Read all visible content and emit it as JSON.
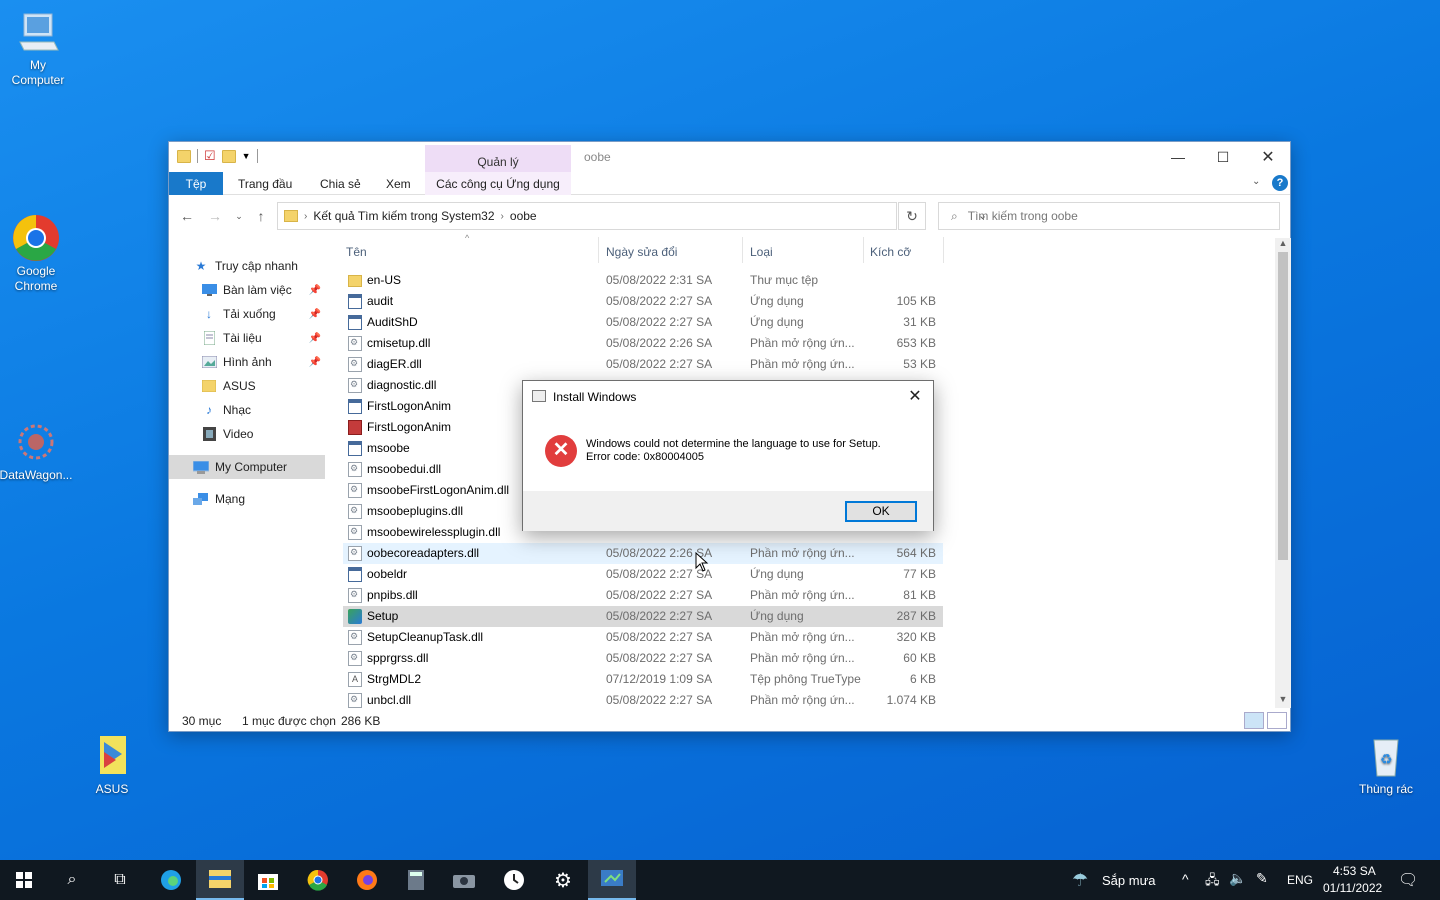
{
  "desktop": {
    "icons": [
      {
        "label": "My\nComputer",
        "line1": "My",
        "line2": "Computer"
      },
      {
        "line1": "Google",
        "line2": "Chrome"
      },
      {
        "line1": "DataWagon..."
      },
      {
        "line1": "ASUS"
      },
      {
        "line1": "Thùng rác"
      }
    ]
  },
  "explorer": {
    "title": "oobe",
    "manage_tab": "Quản lý",
    "ribbon_tabs": [
      "Tệp",
      "Trang đầu",
      "Chia sẻ",
      "Xem",
      "Các công cụ Ứng dụng"
    ],
    "address": {
      "crumb1": "Kết quả Tìm kiếm trong System32",
      "crumb2": "oobe"
    },
    "search_placeholder": "Tìm kiếm trong oobe",
    "nav": [
      {
        "label": "Truy cập nhanh",
        "icon": "star-icon"
      },
      {
        "label": "Bàn làm việc",
        "icon": "desktop-icon",
        "pinned": true
      },
      {
        "label": "Tải xuống",
        "icon": "download-icon",
        "pinned": true
      },
      {
        "label": "Tài liệu",
        "icon": "document-icon",
        "pinned": true
      },
      {
        "label": "Hình ảnh",
        "icon": "picture-icon",
        "pinned": true
      },
      {
        "label": "ASUS",
        "icon": "folder-icon"
      },
      {
        "label": "Nhạc",
        "icon": "music-icon"
      },
      {
        "label": "Video",
        "icon": "video-icon"
      },
      {
        "label": "My Computer",
        "icon": "computer-icon",
        "selected": true
      },
      {
        "label": "Mạng",
        "icon": "network-icon"
      }
    ],
    "columns": [
      "Tên",
      "Ngày sửa đổi",
      "Loại",
      "Kích cỡ"
    ],
    "files": [
      {
        "name": "en-US",
        "date": "05/08/2022 2:31 SA",
        "type": "Thư mục tệp",
        "size": "",
        "icon": "folder"
      },
      {
        "name": "audit",
        "date": "05/08/2022 2:27 SA",
        "type": "Ứng dụng",
        "size": "105 KB",
        "icon": "app"
      },
      {
        "name": "AuditShD",
        "date": "05/08/2022 2:27 SA",
        "type": "Ứng dụng",
        "size": "31 KB",
        "icon": "app"
      },
      {
        "name": "cmisetup.dll",
        "date": "05/08/2022 2:26 SA",
        "type": "Phần mở rộng ứn...",
        "size": "653 KB",
        "icon": "dll"
      },
      {
        "name": "diagER.dll",
        "date": "05/08/2022 2:27 SA",
        "type": "Phần mở rộng ứn...",
        "size": "53 KB",
        "icon": "dll"
      },
      {
        "name": "diagnostic.dll",
        "date": "",
        "type": "",
        "size": "",
        "icon": "dll"
      },
      {
        "name": "FirstLogonAnim",
        "date": "",
        "type": "",
        "size": "",
        "icon": "app"
      },
      {
        "name": "FirstLogonAnim",
        "date": "",
        "type": "",
        "size": "",
        "icon": "red"
      },
      {
        "name": "msoobe",
        "date": "",
        "type": "",
        "size": "",
        "icon": "app"
      },
      {
        "name": "msoobedui.dll",
        "date": "",
        "type": "",
        "size": "",
        "icon": "dll"
      },
      {
        "name": "msoobeFirstLogonAnim.dll",
        "date": "",
        "type": "",
        "size": "",
        "icon": "dll"
      },
      {
        "name": "msoobeplugins.dll",
        "date": "",
        "type": "",
        "size": "",
        "icon": "dll"
      },
      {
        "name": "msoobewirelessplugin.dll",
        "date": "",
        "type": "",
        "size": "",
        "icon": "dll"
      },
      {
        "name": "oobecoreadapters.dll",
        "date": "05/08/2022 2:26 SA",
        "type": "Phần mở rộng ứn...",
        "size": "564 KB",
        "icon": "dll",
        "hover": true
      },
      {
        "name": "oobeldr",
        "date": "05/08/2022 2:27 SA",
        "type": "Ứng dụng",
        "size": "77 KB",
        "icon": "app"
      },
      {
        "name": "pnpibs.dll",
        "date": "05/08/2022 2:27 SA",
        "type": "Phần mở rộng ứn...",
        "size": "81 KB",
        "icon": "dll"
      },
      {
        "name": "Setup",
        "date": "05/08/2022 2:27 SA",
        "type": "Ứng dụng",
        "size": "287 KB",
        "icon": "setup",
        "selected": true
      },
      {
        "name": "SetupCleanupTask.dll",
        "date": "05/08/2022 2:27 SA",
        "type": "Phần mở rộng ứn...",
        "size": "320 KB",
        "icon": "dll"
      },
      {
        "name": "spprgrss.dll",
        "date": "05/08/2022 2:27 SA",
        "type": "Phần mở rộng ứn...",
        "size": "60 KB",
        "icon": "dll"
      },
      {
        "name": "StrgMDL2",
        "date": "07/12/2019 1:09 SA",
        "type": "Tệp phông TrueType",
        "size": "6 KB",
        "icon": "font"
      },
      {
        "name": "unbcl.dll",
        "date": "05/08/2022 2:27 SA",
        "type": "Phần mở rộng ứn...",
        "size": "1.074 KB",
        "icon": "dll"
      }
    ],
    "status": {
      "count": "30 mục",
      "selected": "1 mục được chọn",
      "size": "286 KB"
    }
  },
  "dialog": {
    "title": "Install Windows",
    "line1": "Windows could not determine the language to use for Setup.",
    "line2": "Error code: 0x80004005",
    "ok": "OK"
  },
  "taskbar": {
    "weather": "Sắp mưa",
    "lang": "ENG",
    "time": "4:53 SA",
    "date": "01/11/2022"
  },
  "colors": {
    "accent": "#1979ca",
    "manage_tab": "#eeddf6",
    "error": "#e13d3d"
  }
}
